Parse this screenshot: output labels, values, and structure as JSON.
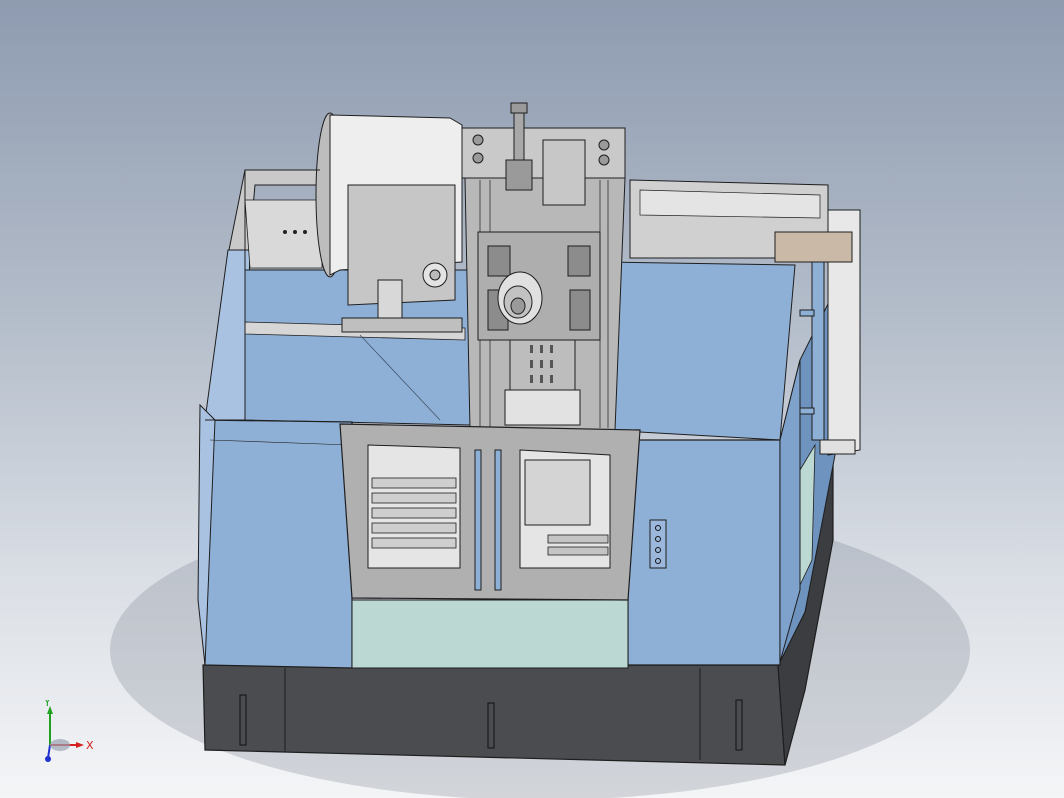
{
  "viewport": {
    "background_top": "#8e9bb0",
    "background_bottom": "#f4f5f7",
    "model_name": ""
  },
  "colors": {
    "panel_blue": "#8fb0d6",
    "panel_blue_dark": "#6f93bf",
    "frame_gray": "#c9c9c9",
    "frame_gray_dark": "#9a9a9a",
    "base_dark": "#4a4c50",
    "glass": "#bcd8d2",
    "spindle_white": "#eeeeee",
    "edge": "#1e1e1e"
  },
  "triad": {
    "x_label": "X",
    "y_label": "Y",
    "x_color": "#d42020",
    "y_color": "#20a020",
    "z_color": "#2030d0",
    "icon": "reference-triad-icon"
  }
}
